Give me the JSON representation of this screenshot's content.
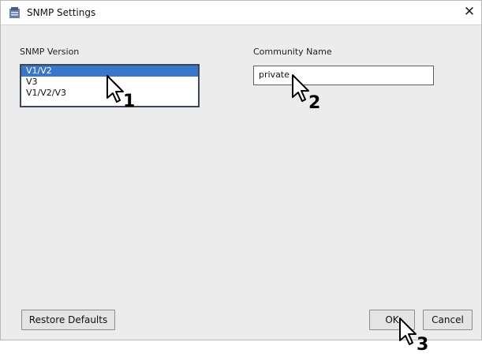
{
  "window": {
    "title": "SNMP Settings",
    "close_glyph": "✕"
  },
  "snmp_version": {
    "label": "SNMP Version",
    "options": [
      "V1/V2",
      "V3",
      "V1/V2/V3"
    ],
    "selected": "V1/V2"
  },
  "community": {
    "label": "Community Name",
    "value": "private"
  },
  "buttons": {
    "restore_defaults": "Restore Defaults",
    "ok": "OK",
    "cancel": "Cancel"
  },
  "step_markers": [
    "1",
    "2",
    "3"
  ],
  "colors": {
    "selection": "#3a76c9",
    "dialog_background": "#ececec"
  }
}
